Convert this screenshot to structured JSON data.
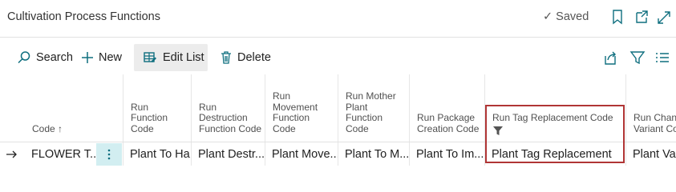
{
  "title": "Cultivation Process Functions",
  "status": "✓ Saved",
  "toolbar": {
    "search": "Search",
    "new": "New",
    "edit_list": "Edit List",
    "delete": "Delete"
  },
  "columns": [
    {
      "label": "Code ↑"
    },
    {
      "label": "Run Function Code"
    },
    {
      "label": "Run Destruction Function Code"
    },
    {
      "label": "Run Movement Function Code"
    },
    {
      "label": "Run Mother Plant Function Code"
    },
    {
      "label": "Run Package Creation Code"
    },
    {
      "label": "Run Tag Replacement Code"
    },
    {
      "label": "Run Change Variant Code"
    }
  ],
  "row": {
    "code": "FLOWER T...",
    "run_function": "Plant To Ha...",
    "run_destruction": "Plant Destr...",
    "run_movement": "Plant Move...",
    "run_mother_plant": "Plant To M...",
    "run_package": "Plant To Im...",
    "run_tag_replacement": "Plant Tag Replacement",
    "run_change_variant": "Plant Vari"
  },
  "accent_color": "#0f6f7f",
  "highlight_color": "#b03535"
}
